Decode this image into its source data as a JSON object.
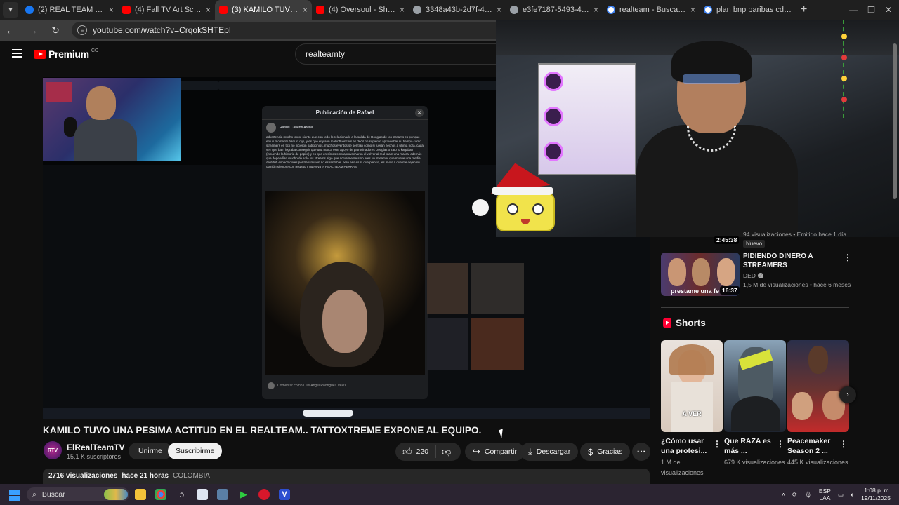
{
  "browser": {
    "tabs": [
      {
        "title": "(2) REAL TEAM PRRASI | F",
        "color": "#1877f2",
        "active": false
      },
      {
        "title": "(4) Fall TV Art Screensave",
        "color": "#ff0000",
        "active": false
      },
      {
        "title": "(3) KAMILO TUVO UNA PE",
        "color": "#ff0000",
        "active": true
      },
      {
        "title": "(4) Oversoul - Shaman Ki",
        "color": "#ff0000",
        "active": false
      },
      {
        "title": "3348a43b-2d7f-440a-91b",
        "color": "#9aa0a6",
        "active": false
      },
      {
        "title": "e3fe7187-5493-4079-a6e",
        "color": "#9aa0a6",
        "active": false
      },
      {
        "title": "realteam - Buscar con Go",
        "color": "#4285f4",
        "active": false
      },
      {
        "title": "plan bnp paribas cdf - Bu",
        "color": "#4285f4",
        "active": false
      }
    ],
    "url": "youtube.com/watch?v=CrqokSHTEpI"
  },
  "youtube": {
    "logo_word": "Premium",
    "country_code": "CO",
    "search_value": "realteamty"
  },
  "video": {
    "title": "KAMILO TUVO UNA PESIMA ACTITUD EN EL REALTEAM.. TATTOXTREME EXPONE AL EQUIPO.",
    "channel": "ElRealTeamTV",
    "avatar_text": "RTV",
    "subscribers": "15,1 K suscriptores",
    "join_label": "Unirme",
    "subscribe_label": "Suscribirme",
    "likes": "220",
    "share_label": "Compartir",
    "download_label": "Descargar",
    "thanks_label": "Gracias",
    "views": "2716 visualizaciones",
    "posted": "hace 21 horas",
    "country": "COLOMBIA"
  },
  "embedded_post": {
    "header": "Publicación de Rafael",
    "author": "Rafael Canenti Arena",
    "text": "advertencia mucho texto: siento que con todo lo relacionado a la salida de Douglas de los streams es por qué en un momento bam lo dijo, y es que el y son mal influencers es decir no supieron aprovechar su tiempo como streamers en tick no hicieron patrocinios, muchos eventos se sentían como si fueran hechos a última hora, cada vez que bam lograba conseguir que una marca este apoyo de patrocinadores Douglas o Tato lo kagaban (incuendo la historia de pepito) y es que en síntesis no aprovecharon el volver al real team una marca. además que dependían mucho de solo los streams algo que actualmente sino eres un streamer que mueve una media de 6000 espectadores por transmisión no es rentable. pero eso es lo que pienso, les invito a que me dejen su opinión siempre con respeto y que viva el REAL TEAM PERRAS",
    "comment_placeholder": "Comentar como Luis Angel Rodriguez Velez"
  },
  "sidebar": {
    "rec1": {
      "duration": "2:45:38",
      "meta": "94 visualizaciones • Emitido hace 1 día",
      "badge": "Nuevo"
    },
    "rec2": {
      "title": "PIDIENDO DINERO A STREAMERS",
      "channel": "DED",
      "stats": "1,5 M de visualizaciones • hace 6 meses",
      "duration": "16:37",
      "thumb_caption": "prestame una fe"
    },
    "shorts_title": "Shorts",
    "shorts": [
      {
        "title": "¿Cómo usar una protesi...",
        "views": "1 M de visualizaciones",
        "caption": "A VER"
      },
      {
        "title": "Que RAZA es más ...",
        "views": "679 K visualizaciones",
        "caption": ""
      },
      {
        "title": "Peacemaker Season 2 ...",
        "views": "445 K visualizaciones",
        "caption": ""
      }
    ]
  },
  "taskbar": {
    "search_placeholder": "Buscar",
    "lang_top": "ESP",
    "lang_bottom": "LAA",
    "time": "1:08 p. m.",
    "date": "19/11/2025"
  },
  "colors": {
    "yt_red": "#ff0000",
    "bg": "#0f0f0f",
    "pill": "#272727"
  }
}
